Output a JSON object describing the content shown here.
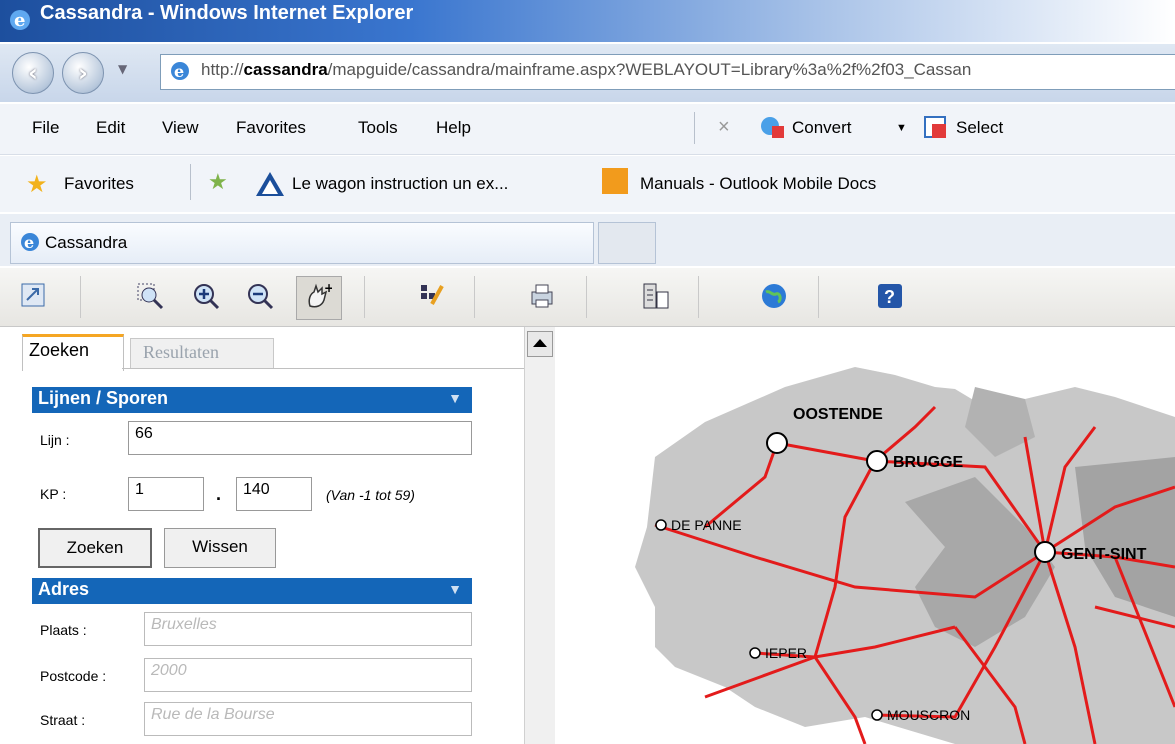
{
  "window": {
    "title": "Cassandra - Windows Internet Explorer"
  },
  "address": {
    "url_prefix": "http://",
    "url_host": "cassandra",
    "url_rest": "/mapguide/cassandra/mainframe.aspx?WEBLAYOUT=Library%3a%2f%2f03_Cassan"
  },
  "menu": {
    "file": "File",
    "edit": "Edit",
    "view": "View",
    "favorites": "Favorites",
    "tools": "Tools",
    "help": "Help",
    "close": "×",
    "convert": "Convert",
    "select": "Select"
  },
  "favbar": {
    "favorites": "Favorites",
    "link1": "Le wagon instruction  un ex...",
    "link2": "Manuals - Outlook Mobile Docs"
  },
  "tabs": {
    "active": "Cassandra"
  },
  "panel": {
    "tab_search": "Zoeken",
    "tab_results": "Resultaten",
    "section1": "Lijnen / Sporen",
    "lijn_label": "Lijn :",
    "lijn_value": "66",
    "kp_label": "KP :",
    "kp_value1": "1",
    "kp_dot": ".",
    "kp_value2": "140",
    "kp_hint": "(Van -1 tot 59)",
    "search_button": "Zoeken",
    "clear_button": "Wissen",
    "section2": "Adres",
    "plaats_label": "Plaats :",
    "plaats_placeholder": "Bruxelles",
    "postcode_label": "Postcode :",
    "postcode_placeholder": "2000",
    "straat_label": "Straat :",
    "straat_placeholder": "Rue de la Bourse",
    "collapse_glyph": "▼"
  },
  "map": {
    "cities": {
      "oostende": "OOSTENDE",
      "brugge": "BRUGGE",
      "depanne": "DE PANNE",
      "gent": "GENT-SINT",
      "ieper": "IEPER",
      "mouscron": "MOUSCRON"
    }
  },
  "colors": {
    "section_header": "#1466b8",
    "rail": "#e31b1b",
    "land": "#c8c8c8",
    "land_dark": "#a3a3a3",
    "active_tab_accent": "#f5a623"
  }
}
